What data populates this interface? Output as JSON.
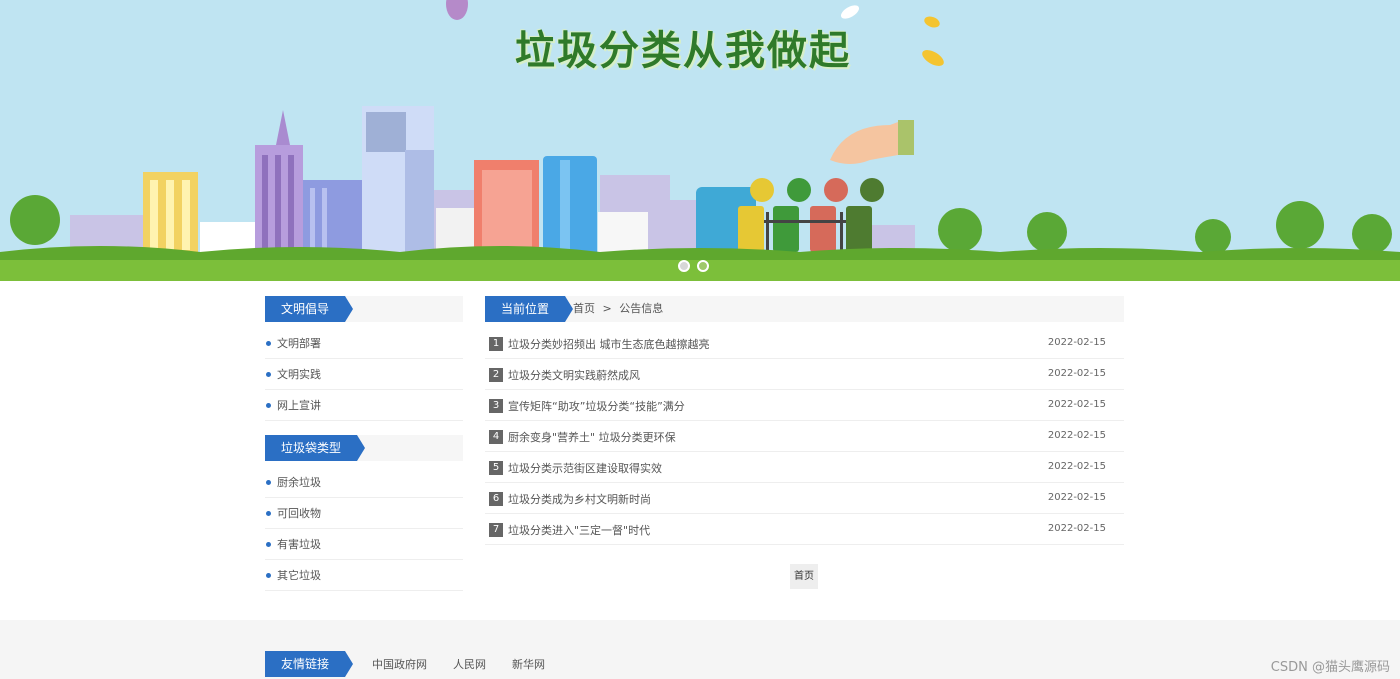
{
  "banner": {
    "title": "垃圾分类从我做起",
    "slides": 2
  },
  "sidebar": {
    "sections": [
      {
        "title": "文明倡导",
        "items": [
          "文明部署",
          "文明实践",
          "网上宣讲"
        ]
      },
      {
        "title": "垃圾袋类型",
        "items": [
          "厨余垃圾",
          "可回收物",
          "有害垃圾",
          "其它垃圾"
        ]
      }
    ]
  },
  "main": {
    "location_label": "当前位置",
    "breadcrumb": {
      "home": "首页",
      "separator": ">",
      "current": "公告信息"
    },
    "articles": [
      {
        "num": "1",
        "title": "垃圾分类妙招频出 城市生态底色越擦越亮",
        "date": "2022-02-15"
      },
      {
        "num": "2",
        "title": "垃圾分类文明实践蔚然成风",
        "date": "2022-02-15"
      },
      {
        "num": "3",
        "title": "宣传矩阵“助攻”垃圾分类“技能”满分",
        "date": "2022-02-15"
      },
      {
        "num": "4",
        "title": "厨余变身\"营养土\" 垃圾分类更环保",
        "date": "2022-02-15"
      },
      {
        "num": "5",
        "title": "垃圾分类示范街区建设取得实效",
        "date": "2022-02-15"
      },
      {
        "num": "6",
        "title": "垃圾分类成为乡村文明新时尚",
        "date": "2022-02-15"
      },
      {
        "num": "7",
        "title": "垃圾分类进入\"三定一督\"时代",
        "date": "2022-02-15"
      }
    ],
    "pager_label": "首页"
  },
  "footer": {
    "title": "友情链接",
    "links": [
      "中国政府网",
      "人民网",
      "新华网"
    ],
    "watermark": "CSDN @猫头鹰源码"
  },
  "colors": {
    "accent": "#2b6fc4",
    "sky": "#bfe4f2",
    "grass": "#7cbf3a"
  }
}
